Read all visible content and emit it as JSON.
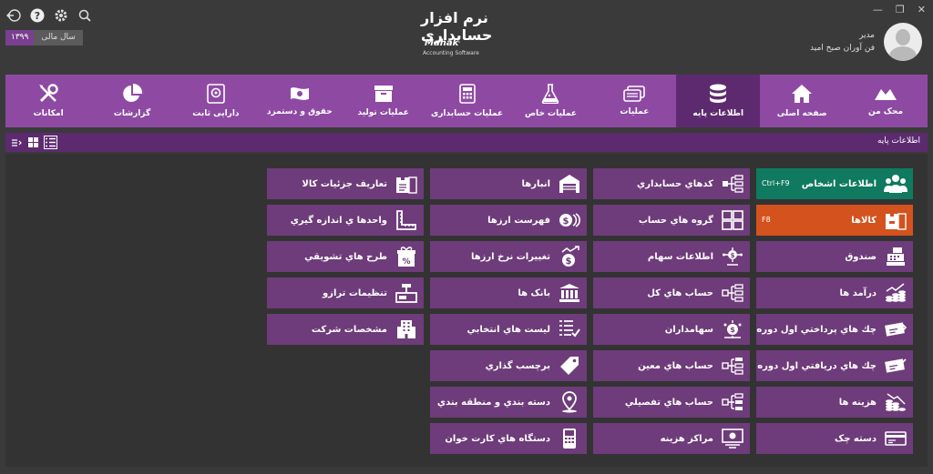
{
  "header": {
    "fiscal_year_label": "سال مالی",
    "fiscal_year_value": "۱۳۹۹",
    "logo_fa": "نرم افزار حسابداری",
    "logo_en": "Mahak",
    "logo_sub": "Accounting Software",
    "user_name": "مدیر",
    "company": "فن آوران صبح امید",
    "icons": [
      "logout-icon",
      "help-icon",
      "settings-icon",
      "search-icon"
    ]
  },
  "ribbon": {
    "tabs": [
      {
        "label": "محک من",
        "icon": "mahak-icon"
      },
      {
        "label": "صفحه اصلی",
        "icon": "home-icon"
      },
      {
        "label": "اطلاعات پایه",
        "icon": "database-icon",
        "active": true
      },
      {
        "label": "عملیات",
        "icon": "operations-icon"
      },
      {
        "label": "عملیات خاص",
        "icon": "flask-icon"
      },
      {
        "label": "عملیات حسابداری",
        "icon": "calculator-icon"
      },
      {
        "label": "عملیات تولید",
        "icon": "box-icon"
      },
      {
        "label": "حقوق و دستمزد",
        "icon": "money-icon"
      },
      {
        "label": "دارایی ثابت",
        "icon": "safe-icon"
      },
      {
        "label": "گزارشات",
        "icon": "pie-chart-icon"
      },
      {
        "label": "امکانات",
        "icon": "tools-icon"
      }
    ]
  },
  "breadcrumb": "اطلاعات پایه",
  "columns": [
    [
      {
        "label": "اطلاعات اشخاص",
        "shortcut": "Ctrl+F9",
        "color": "#0f7a5f",
        "icon": "people-icon"
      },
      {
        "label": "کالاها",
        "shortcut": "F8",
        "color": "#d4521e",
        "icon": "goods-icon"
      },
      {
        "label": "صندوق",
        "icon": "cash-register-icon"
      },
      {
        "label": "درآمد ها",
        "icon": "income-icon"
      },
      {
        "label": "چك هاي پرداختي اول دوره",
        "icon": "paid-check-icon"
      },
      {
        "label": "چك هاي دريافتي اول دوره",
        "icon": "received-check-icon"
      },
      {
        "label": "هزينه ها",
        "icon": "expense-icon"
      },
      {
        "label": "دسته چک",
        "icon": "checkbook-icon"
      }
    ],
    [
      {
        "label": "كدهاي حسابداري",
        "icon": "account-codes-icon"
      },
      {
        "label": "گروه هاي حساب",
        "icon": "account-groups-icon"
      },
      {
        "label": "اطلاعات سهام",
        "icon": "shares-icon"
      },
      {
        "label": "حساب هاي کل",
        "icon": "general-accounts-icon"
      },
      {
        "label": "سهامداران",
        "icon": "shareholders-icon"
      },
      {
        "label": "حساب هاي معين",
        "icon": "specific-accounts-icon"
      },
      {
        "label": "حساب هاي تفصيلي",
        "icon": "detailed-accounts-icon"
      },
      {
        "label": "مراكز هزينه",
        "icon": "cost-centers-icon"
      }
    ],
    [
      {
        "label": "انبارها",
        "icon": "warehouse-icon"
      },
      {
        "label": "فهرست ارزها",
        "icon": "currency-list-icon"
      },
      {
        "label": "تغييرات نرخ ارزها",
        "icon": "currency-rate-icon"
      },
      {
        "label": "بانک ها",
        "icon": "bank-icon"
      },
      {
        "label": "ليست هاي انتخابي",
        "icon": "checklist-icon"
      },
      {
        "label": "برچسب گذاري",
        "icon": "tag-icon"
      },
      {
        "label": "دسته بندي و منطقه بندي",
        "icon": "location-icon"
      },
      {
        "label": "دستگاه هاي کارت خوان",
        "icon": "pos-icon"
      }
    ],
    [
      {
        "label": "تعاريف جزئيات كالا",
        "icon": "item-details-icon"
      },
      {
        "label": "واحدها ي اندازه گيري",
        "icon": "ruler-icon"
      },
      {
        "label": "طرح هاي تشويقي",
        "icon": "promotion-icon"
      },
      {
        "label": "تنظيمات ترازو",
        "icon": "scale-icon"
      },
      {
        "label": "مشخصات شركت",
        "icon": "company-icon"
      }
    ]
  ]
}
